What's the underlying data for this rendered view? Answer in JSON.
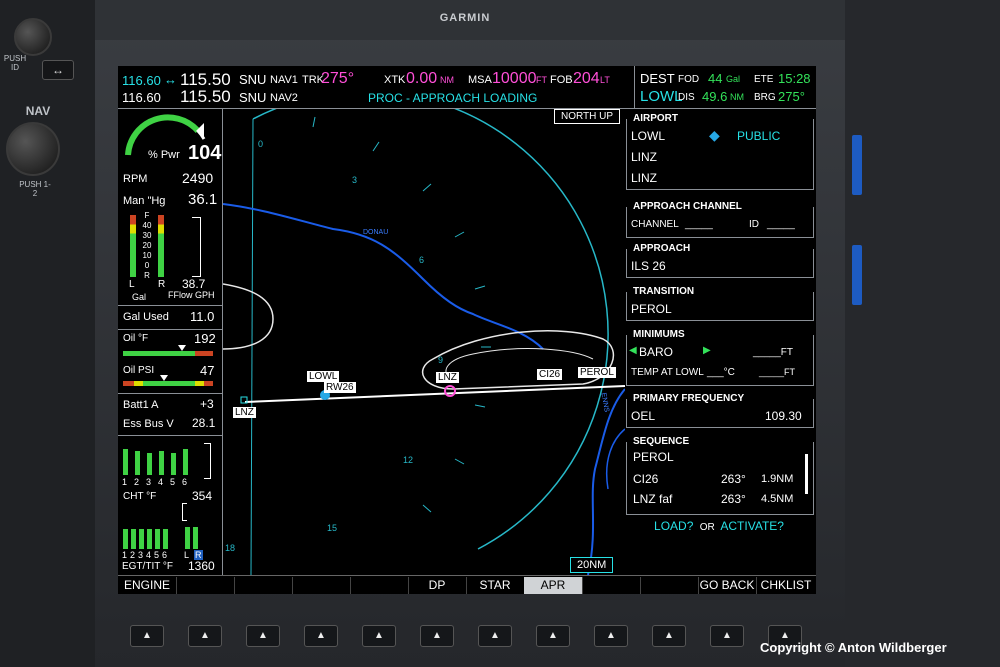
{
  "bezel": {
    "brand": "GARMIN",
    "left_labels": {
      "push_id": "PUSH ID",
      "nav": "NAV",
      "push_12": "PUSH 1-2"
    }
  },
  "topbar": {
    "nav1": {
      "standby": "116.60",
      "active": "115.50",
      "ident": "SNU",
      "label": "NAV1"
    },
    "nav2": {
      "standby": "116.60",
      "active": "115.50",
      "ident": "SNU",
      "label": "NAV2"
    },
    "swap_symbol": "↔",
    "trk_label": "TRK",
    "trk_value": "275°",
    "xtk_label": "XTK",
    "xtk_value": "0.00",
    "xtk_unit": "NM",
    "msa_label": "MSA",
    "msa_value": "10000",
    "msa_unit": "FT",
    "fob_label": "FOB",
    "fob_value": "204",
    "fob_unit": "LT",
    "status": "PROC - APPROACH LOADING",
    "dest_label": "DEST",
    "dest_value": "LOWL",
    "fod_label": "FOD",
    "fod_value": "44",
    "fod_unit": "Gal",
    "ete_label": "ETE",
    "ete_value": "15:28",
    "dis_label": "DIS",
    "dis_value": "49.6",
    "dis_unit": "NM",
    "brg_label": "BRG",
    "brg_value": "275°"
  },
  "engine": {
    "pwr_label": "% Pwr",
    "pwr_value": "104",
    "rpm_label": "RPM",
    "rpm_value": "2490",
    "man_label": "Man \"Hg",
    "man_value": "36.1",
    "fuel_scale": [
      "F",
      "40",
      "30",
      "20",
      "10",
      "0",
      "R"
    ],
    "fuel_lr": {
      "l": "L",
      "r": "R"
    },
    "fflow_value": "38.7",
    "gal_label": "Gal",
    "fflow_label": "FFlow GPH",
    "gal_used_label": "Gal Used",
    "gal_used_value": "11.0",
    "oil_temp_label": "Oil °F",
    "oil_temp_value": "192",
    "oil_psi_label": "Oil PSI",
    "oil_psi_value": "47",
    "batt_label": "Batt1 A",
    "batt_value": "+3",
    "essbus_label": "Ess Bus V",
    "essbus_value": "28.1",
    "cyl_numbers": [
      "1",
      "2",
      "3",
      "4",
      "5",
      "6"
    ],
    "cht_label": "CHT °F",
    "cht_value": "354",
    "egt_numbers": [
      "1",
      "2",
      "3",
      "4",
      "5",
      "6"
    ],
    "egt_lr": {
      "l": "L",
      "r": "R"
    },
    "egt_label": "EGT/TIT °F",
    "egt_value": "1360"
  },
  "map": {
    "orientation": "NORTH UP",
    "range": "20NM",
    "compass_numbers": [
      "0",
      "3",
      "6",
      "9",
      "12",
      "15",
      "18"
    ],
    "waypoints": {
      "lnz_left": "LNZ",
      "lowl": "LOWL",
      "rw26": "RW26",
      "lnz_vor": "LNZ",
      "ci26": "CI26",
      "perol": "PEROL"
    },
    "rivers": {
      "donau": "DONAU",
      "enns": "ENNS"
    }
  },
  "panel": {
    "airport": {
      "title": "AIRPORT",
      "ident": "LOWL",
      "type": "PUBLIC",
      "line2": "LINZ",
      "line3": "LINZ"
    },
    "approach_channel": {
      "title": "APPROACH CHANNEL",
      "channel_label": "CHANNEL",
      "channel_value": "_____",
      "id_label": "ID",
      "id_value": "_____"
    },
    "approach": {
      "title": "APPROACH",
      "value": "ILS 26"
    },
    "transition": {
      "title": "TRANSITION",
      "value": "PEROL"
    },
    "minimums": {
      "title": "MINIMUMS",
      "baro_label": "BARO",
      "baro_value": "_____FT",
      "temp_label": "TEMP AT LOWL",
      "temp_value": "___°C",
      "temp_ft": "_____FT"
    },
    "primary_frequency": {
      "title": "PRIMARY FREQUENCY",
      "ident": "OEL",
      "value": "109.30"
    },
    "sequence": {
      "title": "SEQUENCE",
      "rows": [
        {
          "name": "PEROL",
          "course": "",
          "dist": ""
        },
        {
          "name": "CI26",
          "course": "263°",
          "dist": "1.9NM"
        },
        {
          "name": "LNZ faf",
          "course": "263°",
          "dist": "4.5NM"
        }
      ]
    },
    "load_label": "LOAD?",
    "or_label": "OR",
    "activate_label": "ACTIVATE?"
  },
  "softkeys": {
    "engine": "ENGINE",
    "dp": "DP",
    "star": "STAR",
    "apr": "APR",
    "go_back": "GO BACK",
    "chklist": "CHKLIST"
  },
  "copyright": "Copyright © Anton Wildberger",
  "colors": {
    "cyan": "#27e1e6",
    "magenta": "#ff4fd8",
    "green": "#33e25a",
    "white": "#ffffff",
    "blue_river": "#1a5ce8"
  }
}
